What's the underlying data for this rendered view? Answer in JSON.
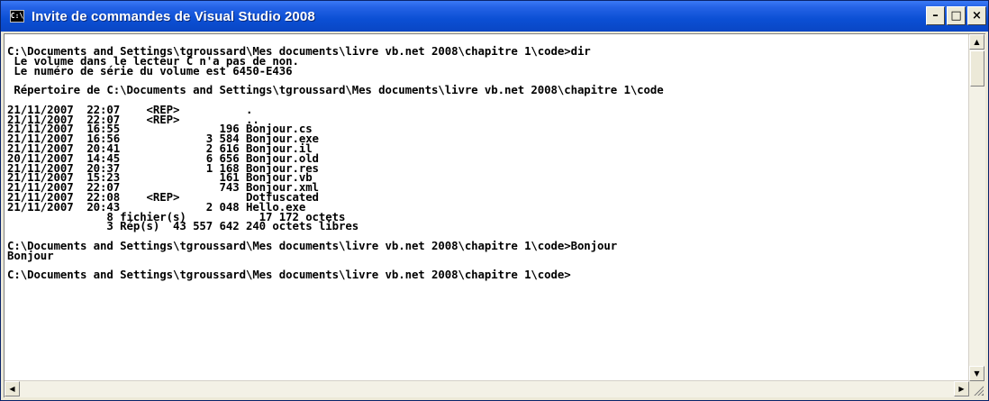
{
  "window": {
    "title": "Invite de commandes de Visual Studio 2008",
    "icon_text": "C:\\",
    "controls": {
      "minimize": "–",
      "maximize": "□",
      "close": "×"
    }
  },
  "console": {
    "lines": [
      "C:\\Documents and Settings\\tgroussard\\Mes documents\\livre vb.net 2008\\chapitre 1\\code>dir",
      " Le volume dans le lecteur C n'a pas de non.",
      " Le numéro de série du volume est 6450-E436",
      "",
      " Répertoire de C:\\Documents and Settings\\tgroussard\\Mes documents\\livre vb.net 2008\\chapitre 1\\code",
      "",
      "21/11/2007  22:07    <REP>          .",
      "21/11/2007  22:07    <REP>          ..",
      "21/11/2007  16:55               196 Bonjour.cs",
      "21/11/2007  16:56             3 584 Bonjour.exe",
      "21/11/2007  20:41             2 616 Bonjour.il",
      "20/11/2007  14:45             6 656 Bonjour.old",
      "21/11/2007  20:37             1 168 Bonjour.res",
      "21/11/2007  15:23               161 Bonjour.vb",
      "21/11/2007  22:07               743 Bonjour.xml",
      "21/11/2007  22:08    <REP>          Dotfuscated",
      "21/11/2007  20:43             2 048 Hello.exe",
      "               8 fichier(s)           17 172 octets",
      "               3 Rép(s)  43 557 642 240 octets libres",
      "",
      "C:\\Documents and Settings\\tgroussard\\Mes documents\\livre vb.net 2008\\chapitre 1\\code>Bonjour",
      "Bonjour",
      "",
      "C:\\Documents and Settings\\tgroussard\\Mes documents\\livre vb.net 2008\\chapitre 1\\code>"
    ]
  },
  "scrollbars": {
    "up": "▲",
    "down": "▼",
    "left": "◀",
    "right": "▶"
  }
}
